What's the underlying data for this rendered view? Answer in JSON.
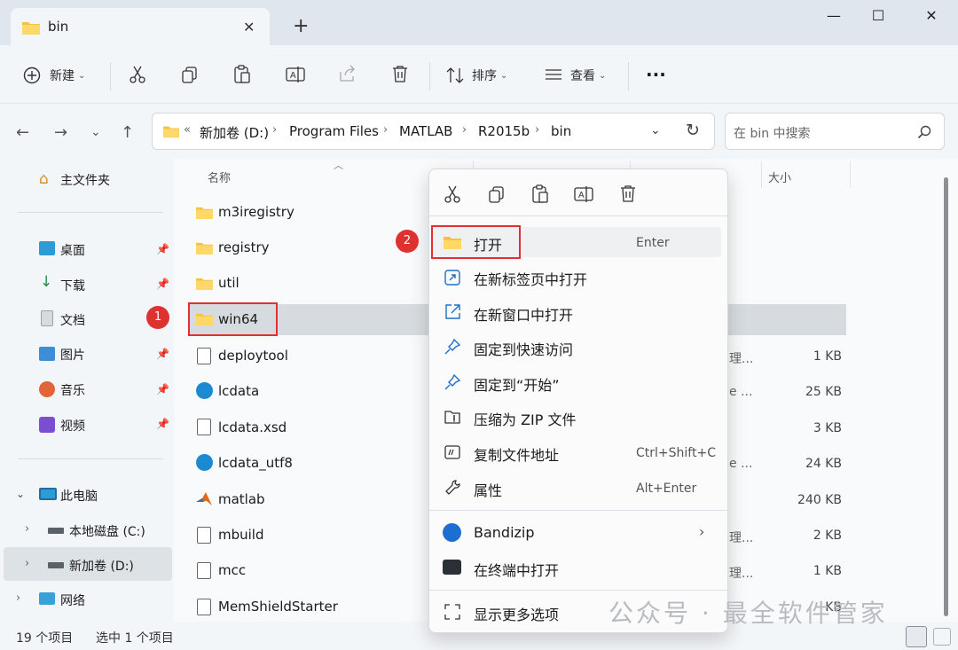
{
  "window": {
    "tab_title": "bin",
    "tab_close": "✕",
    "new_tab": "+",
    "minimize": "—",
    "maximize": "☐",
    "close": "✕"
  },
  "toolbar": {
    "new_label": "新建",
    "sort_label": "排序",
    "view_label": "查看",
    "more": "···"
  },
  "address": {
    "overflow": "«",
    "crumbs": [
      "新加卷 (D:)",
      "Program Files",
      "MATLAB",
      "R2015b",
      "bin"
    ],
    "search_placeholder": "在 bin 中搜索"
  },
  "sidebar": {
    "home": "主文件夹",
    "quick": [
      "桌面",
      "下载",
      "文档",
      "图片",
      "音乐",
      "视频"
    ],
    "this_pc": "此电脑",
    "drives": [
      "本地磁盘 (C:)",
      "新加卷 (D:)"
    ],
    "network": "网络"
  },
  "columns": {
    "name": "名称",
    "size": "大小"
  },
  "files": [
    {
      "name": "m3iregistry",
      "type": "",
      "size": ""
    },
    {
      "name": "registry",
      "type": "",
      "size": ""
    },
    {
      "name": "util",
      "type": "",
      "size": ""
    },
    {
      "name": "win64",
      "type": "",
      "size": ""
    },
    {
      "name": "deploytool",
      "type": "理...",
      "size": "1 KB"
    },
    {
      "name": "lcdata",
      "type": "e ...",
      "size": "25 KB"
    },
    {
      "name": "lcdata.xsd",
      "type": "",
      "size": "3 KB"
    },
    {
      "name": "lcdata_utf8",
      "type": "e ...",
      "size": "24 KB"
    },
    {
      "name": "matlab",
      "type": "",
      "size": "240 KB"
    },
    {
      "name": "mbuild",
      "type": "理...",
      "size": "2 KB"
    },
    {
      "name": "mcc",
      "type": "理...",
      "size": "1 KB"
    },
    {
      "name": "MemShieldStarter",
      "type": "",
      "size": "KB"
    }
  ],
  "status": {
    "count": "19 个项目",
    "selected": "选中 1 个项目"
  },
  "badges": [
    "1",
    "2"
  ],
  "context_menu": {
    "items": [
      {
        "label": "打开",
        "key": "Enter"
      },
      {
        "label": "在新标签页中打开",
        "key": ""
      },
      {
        "label": "在新窗口中打开",
        "key": ""
      },
      {
        "label": "固定到快速访问",
        "key": ""
      },
      {
        "label": "固定到“开始”",
        "key": ""
      },
      {
        "label": "压缩为 ZIP 文件",
        "key": ""
      },
      {
        "label": "复制文件地址",
        "key": "Ctrl+Shift+C"
      },
      {
        "label": "属性",
        "key": "Alt+Enter"
      },
      {
        "label": "Bandizip",
        "key": ""
      },
      {
        "label": "在终端中打开",
        "key": ""
      },
      {
        "label": "显示更多选项",
        "key": ""
      }
    ]
  },
  "watermark": "公众号 · 最全软件管家",
  "colors": {
    "accent": "#0067c0",
    "folder": "#f6c243",
    "red": "#e03131"
  }
}
